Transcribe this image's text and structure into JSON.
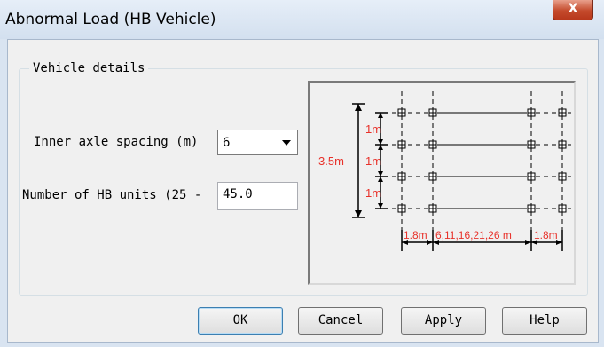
{
  "window": {
    "title": "Abnormal Load (HB Vehicle)",
    "close_glyph": "X"
  },
  "group": {
    "label": "Vehicle details"
  },
  "fields": {
    "inner_axle_spacing_label": "Inner axle spacing (m)",
    "inner_axle_spacing_value": "6",
    "hb_units_label": "Number of HB units (25 -",
    "hb_units_value": "45.0"
  },
  "diagram": {
    "label_total_width": "3.5m",
    "label_gap_top": "1m",
    "label_gap_middle": "1m",
    "label_gap_bottom": "1m",
    "label_left_spacing": "1.8m",
    "label_inner_spacing": "6,11,16,21,26 m",
    "label_right_spacing": "1.8m",
    "dimension_color": "#e8312a"
  },
  "buttons": {
    "ok": "OK",
    "cancel": "Cancel",
    "apply": "Apply",
    "help": "Help"
  }
}
